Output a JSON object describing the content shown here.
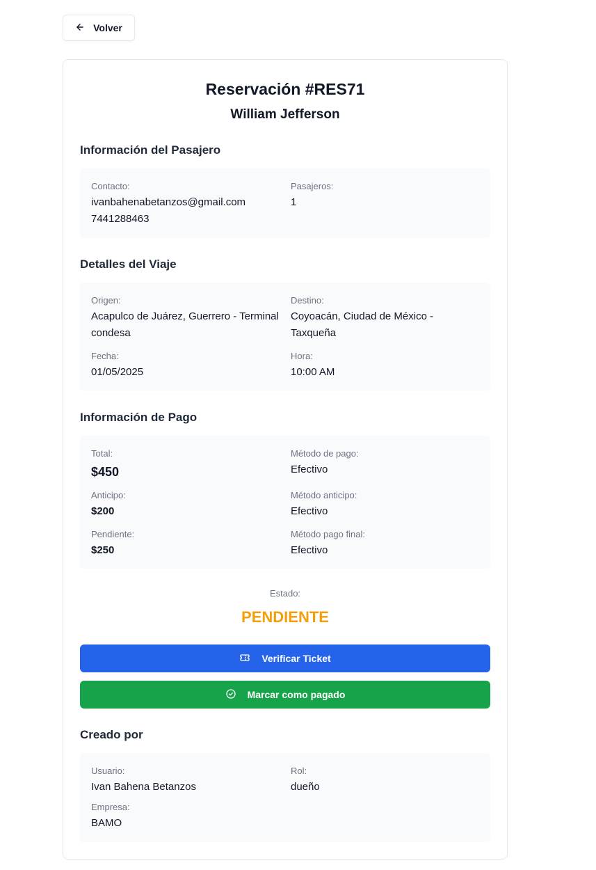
{
  "back": {
    "label": "Volver",
    "icon": "arrow-left-icon"
  },
  "reservation": {
    "title": "Reservación #RES71",
    "customer": "William Jefferson"
  },
  "passenger": {
    "section_title": "Información del Pasajero",
    "contact_label": "Contacto:",
    "email": "ivanbahenabetanzos@gmail.com",
    "phone": "7441288463",
    "passengers_label": "Pasajeros:",
    "passengers": "1"
  },
  "trip": {
    "section_title": "Detalles del Viaje",
    "origin_label": "Origen:",
    "origin": "Acapulco de Juárez, Guerrero - Terminal condesa",
    "destination_label": "Destino:",
    "destination": "Coyoacán, Ciudad de México - Taxqueña",
    "date_label": "Fecha:",
    "date": "01/05/2025",
    "time_label": "Hora:",
    "time": "10:00 AM"
  },
  "payment": {
    "section_title": "Información de Pago",
    "total_label": "Total:",
    "total": "$450",
    "method_label": "Método de pago:",
    "method": "Efectivo",
    "advance_label": "Anticipo:",
    "advance": "$200",
    "advance_method_label": "Método anticipo:",
    "advance_method": "Efectivo",
    "pending_label": "Pendiente:",
    "pending": "$250",
    "final_method_label": "Método pago final:",
    "final_method": "Efectivo"
  },
  "status": {
    "label": "Estado:",
    "value": "PENDIENTE",
    "color": "#f59e0b"
  },
  "actions": {
    "verify": {
      "label": "Verificar Ticket",
      "icon": "ticket-icon",
      "color": "#2563eb"
    },
    "mark_paid": {
      "label": "Marcar como pagado",
      "icon": "check-circle-icon",
      "color": "#16a34a"
    }
  },
  "created_by": {
    "section_title": "Creado por",
    "user_label": "Usuario:",
    "user": "Ivan Bahena Betanzos",
    "role_label": "Rol:",
    "role": "dueño",
    "company_label": "Empresa:",
    "company": "BAMO"
  }
}
